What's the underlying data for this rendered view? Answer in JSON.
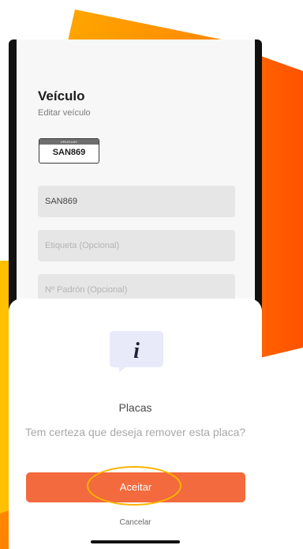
{
  "page": {
    "title": "Veículo",
    "subtitle": "Editar veículo"
  },
  "plate": {
    "country": "URUGUAY",
    "number": "SAN869"
  },
  "form": {
    "plate_value": "SAN869",
    "label_placeholder": "Etiqueta (Opcional)",
    "padron_placeholder": "Nº Padrón (Opcional)"
  },
  "dialog": {
    "icon_glyph": "i",
    "title": "Placas",
    "message": "Tem certeza que deseja remover esta placa?",
    "accept_label": "Aceitar",
    "cancel_label": "Cancelar"
  },
  "colors": {
    "accent": "#f26a3d",
    "highlight": "#ffb300",
    "icon_background": "#e8eafa",
    "background_shape": "#ff7a00"
  }
}
